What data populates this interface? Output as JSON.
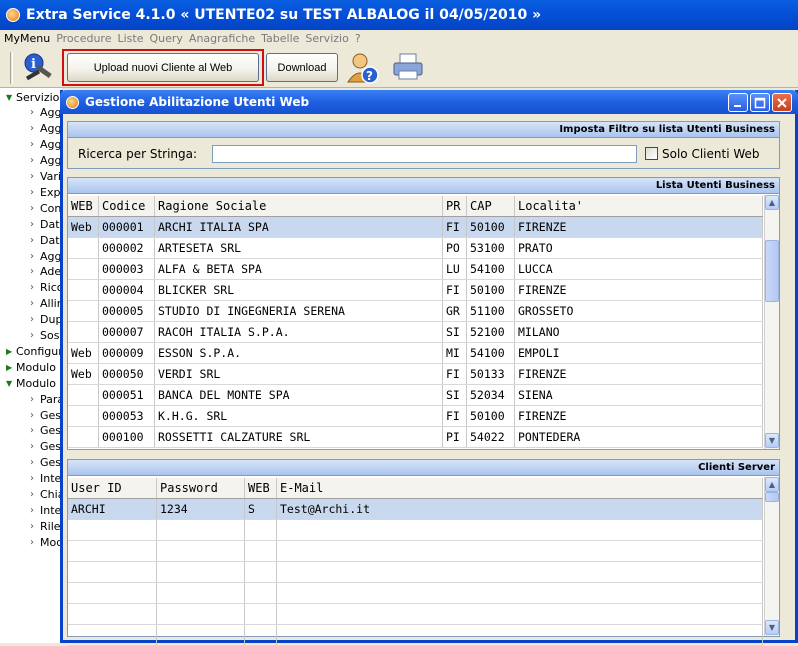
{
  "app": {
    "title": "Extra Service 4.1.0  « UTENTE02 su TEST ALBALOG il 04/05/2010 »"
  },
  "menu": [
    {
      "label": "MyMenu",
      "enabled": true
    },
    {
      "label": "Procedure",
      "enabled": false
    },
    {
      "label": "Liste",
      "enabled": false
    },
    {
      "label": "Query",
      "enabled": false
    },
    {
      "label": "Anagrafiche",
      "enabled": false
    },
    {
      "label": "Tabelle",
      "enabled": false
    },
    {
      "label": "Servizio",
      "enabled": false
    },
    {
      "label": "?",
      "enabled": false
    }
  ],
  "toolbar": {
    "upload_label": "Upload nuovi Cliente al Web",
    "download_label": "Download"
  },
  "tree": [
    {
      "label": "Servizio",
      "kind": "open"
    },
    {
      "label": "Agg",
      "kind": "item"
    },
    {
      "label": "Agg",
      "kind": "item"
    },
    {
      "label": "Agg",
      "kind": "item"
    },
    {
      "label": "Agg",
      "kind": "item"
    },
    {
      "label": "Vari",
      "kind": "item"
    },
    {
      "label": "Exp",
      "kind": "item"
    },
    {
      "label": "Con",
      "kind": "item"
    },
    {
      "label": "Dat",
      "kind": "item"
    },
    {
      "label": "Dat",
      "kind": "item"
    },
    {
      "label": "Agg",
      "kind": "item"
    },
    {
      "label": "Ade",
      "kind": "item"
    },
    {
      "label": "Rico",
      "kind": "item"
    },
    {
      "label": "Allin",
      "kind": "item"
    },
    {
      "label": "Dup",
      "kind": "item"
    },
    {
      "label": "Sos",
      "kind": "item"
    },
    {
      "label": "Configur",
      "kind": "closed"
    },
    {
      "label": "Modulo",
      "kind": "closed"
    },
    {
      "label": "Modulo",
      "kind": "open"
    },
    {
      "label": "Para",
      "kind": "item"
    },
    {
      "label": "Ges",
      "kind": "item"
    },
    {
      "label": "Ges",
      "kind": "item"
    },
    {
      "label": "Ges",
      "kind": "item"
    },
    {
      "label": "Ges",
      "kind": "item"
    },
    {
      "label": "Inte",
      "kind": "item"
    },
    {
      "label": "Chia",
      "kind": "item"
    },
    {
      "label": "Inte",
      "kind": "item"
    },
    {
      "label": "Rile",
      "kind": "item"
    },
    {
      "label": "Mod",
      "kind": "item"
    }
  ],
  "dialog": {
    "title": "Gestione Abilitazione Utenti Web"
  },
  "filter": {
    "header": "Imposta Filtro su lista Utenti Business",
    "search_label": "Ricerca per Stringa:",
    "search_value": "",
    "checkbox_label": "Solo Clienti Web",
    "checkbox_checked": false
  },
  "business": {
    "header": "Lista Utenti Business",
    "columns": [
      "WEB",
      "Codice",
      "Ragione Sociale",
      "PR",
      "CAP",
      "Localita'"
    ],
    "selected_row": 0,
    "rows": [
      [
        "Web",
        "000001",
        "ARCHI ITALIA SPA",
        "FI",
        "50100",
        "FIRENZE"
      ],
      [
        "",
        "000002",
        "ARTESETA SRL",
        "PO",
        "53100",
        "PRATO"
      ],
      [
        "",
        "000003",
        "ALFA & BETA SPA",
        "LU",
        "54100",
        "LUCCA"
      ],
      [
        "",
        "000004",
        "BLICKER SRL",
        "FI",
        "50100",
        "FIRENZE"
      ],
      [
        "",
        "000005",
        "STUDIO DI INGEGNERIA SERENA",
        "GR",
        "51100",
        "GROSSETO"
      ],
      [
        "",
        "000007",
        "RACOH ITALIA S.P.A.",
        "SI",
        "52100",
        "MILANO"
      ],
      [
        "Web",
        "000009",
        "ESSON S.P.A.",
        "MI",
        "54100",
        "EMPOLI"
      ],
      [
        "Web",
        "000050",
        "VERDI SRL",
        "FI",
        "50133",
        "FIRENZE"
      ],
      [
        "",
        "000051",
        "BANCA DEL MONTE SPA",
        "SI",
        "52034",
        "SIENA"
      ],
      [
        "",
        "000053",
        "K.H.G. SRL",
        "FI",
        "50100",
        "FIRENZE"
      ],
      [
        "",
        "000100",
        "ROSSETTI CALZATURE SRL",
        "PI",
        "54022",
        "PONTEDERA"
      ]
    ]
  },
  "server": {
    "header": "Clienti Server",
    "columns": [
      "User ID",
      "Password",
      "WEB",
      "E-Mail"
    ],
    "selected_row": 0,
    "rows": [
      [
        "ARCHI",
        "1234",
        "S",
        "Test@Archi.it"
      ],
      [
        "",
        "",
        "",
        ""
      ],
      [
        "",
        "",
        "",
        ""
      ],
      [
        "",
        "",
        "",
        ""
      ],
      [
        "",
        "",
        "",
        ""
      ],
      [
        "",
        "",
        "",
        ""
      ],
      [
        "",
        "",
        "",
        ""
      ]
    ]
  },
  "colors": {
    "titlebar": "#0550d8",
    "selection": "#c8d8ef",
    "highlight_box": "#d01010"
  }
}
